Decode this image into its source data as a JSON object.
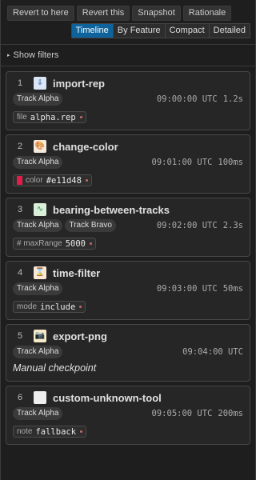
{
  "toolbar": {
    "buttons": [
      "Revert to here",
      "Revert this",
      "Snapshot",
      "Rationale"
    ]
  },
  "view_modes": {
    "items": [
      "Timeline",
      "By Feature",
      "Compact",
      "Detailed"
    ],
    "active": "Timeline"
  },
  "filters": {
    "label": "Show filters",
    "caret": "▸"
  },
  "colors": {
    "accent": "#0e639c",
    "swatch": "#e11d48",
    "param_dot": "#c46a6a"
  },
  "steps": [
    {
      "index": "1",
      "name": "import-rep",
      "icon": "download-icon",
      "icon_glyph": "⇓",
      "tracks": [
        "Track Alpha"
      ],
      "time": "09:00:00 UTC",
      "duration": "1.2s",
      "param": {
        "key": "file",
        "value": "alpha.rep"
      }
    },
    {
      "index": "2",
      "name": "change-color",
      "icon": "palette-icon",
      "icon_glyph": "🎨",
      "tracks": [
        "Track Alpha"
      ],
      "time": "09:01:00 UTC",
      "duration": "100ms",
      "param": {
        "key": "color",
        "value": "#e11d48",
        "swatch": "#e11d48"
      }
    },
    {
      "index": "3",
      "name": "bearing-between-tracks",
      "icon": "bearing-icon",
      "icon_glyph": "∿",
      "tracks": [
        "Track Alpha",
        "Track Bravo"
      ],
      "time": "09:02:00 UTC",
      "duration": "2.3s",
      "param": {
        "key": "# maxRange",
        "value": "5000"
      }
    },
    {
      "index": "4",
      "name": "time-filter",
      "icon": "hourglass-icon",
      "icon_glyph": "⌛",
      "tracks": [
        "Track Alpha"
      ],
      "time": "09:03:00 UTC",
      "duration": "50ms",
      "param": {
        "key": "mode",
        "value": "include"
      }
    },
    {
      "index": "5",
      "name": "export-png",
      "icon": "camera-icon",
      "icon_glyph": "📷",
      "tracks": [
        "Track Alpha"
      ],
      "time": "09:04:00 UTC",
      "duration": "",
      "note": "Manual checkpoint"
    },
    {
      "index": "6",
      "name": "custom-unknown-tool",
      "icon": "blank-icon",
      "icon_glyph": "",
      "tracks": [
        "Track Alpha"
      ],
      "time": "09:05:00 UTC",
      "duration": "200ms",
      "param": {
        "key": "note",
        "value": "fallback"
      }
    }
  ]
}
